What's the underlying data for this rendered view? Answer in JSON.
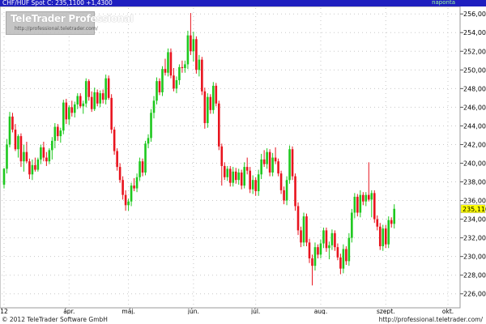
{
  "header": {
    "left_text": "CHF/HUF Spot C: 235,1100 +1,4300",
    "right_text": "naponta"
  },
  "watermark": {
    "name": "TeleTrader Professional",
    "url": "http://professional.teletrader.com/"
  },
  "footer": {
    "copyright": "© 2012 TeleTrader Software GmbH",
    "url": "http://professional.teletrader.com/"
  },
  "colors": {
    "up": "#1ec81e",
    "down": "#e8141e",
    "grid": "#c8c8c8",
    "background": "#ffffff",
    "title_bar": "#1f1fbf",
    "current_price_label": "#ffff00"
  },
  "chart_data": {
    "type": "candlestick",
    "ylim": [
      224.5,
      256.8
    ],
    "yticks": [
      "256,0000",
      "254,0000",
      "252,0000",
      "250,0000",
      "248,0000",
      "246,0000",
      "244,0000",
      "242,0000",
      "240,0000",
      "238,0000",
      "236,0000",
      "234,0000",
      "232,0000",
      "230,0000",
      "228,0000",
      "226,0000"
    ],
    "ytick_values": [
      256,
      254,
      252,
      250,
      248,
      246,
      244,
      242,
      240,
      238,
      236,
      234,
      232,
      230,
      228,
      226
    ],
    "current_price": {
      "label": "235,1100",
      "value": 235.11
    },
    "xticks": [
      {
        "label": "12",
        "index": 0
      },
      {
        "label": "ápr.",
        "index": 23
      },
      {
        "label": "máj.",
        "index": 44
      },
      {
        "label": "jún.",
        "index": 67
      },
      {
        "label": "júl.",
        "index": 89
      },
      {
        "label": "aug.",
        "index": 112
      },
      {
        "label": "szept.",
        "index": 135
      },
      {
        "label": "okt.",
        "index": 157
      }
    ],
    "n_slots": 161,
    "candles": [
      [
        0,
        237.7,
        239.5,
        237.3,
        239.4
      ],
      [
        1,
        239.4,
        242.6,
        238.9,
        242.0
      ],
      [
        2,
        242.0,
        245.5,
        241.7,
        245.0
      ],
      [
        3,
        245.0,
        245.4,
        243.3,
        243.6
      ],
      [
        4,
        243.6,
        244.2,
        241.3,
        241.5
      ],
      [
        5,
        241.5,
        243.1,
        240.6,
        242.9
      ],
      [
        6,
        242.9,
        243.2,
        239.6,
        240.2
      ],
      [
        7,
        240.2,
        242.0,
        239.1,
        241.2
      ],
      [
        8,
        241.2,
        242.3,
        240.0,
        240.2
      ],
      [
        9,
        240.2,
        240.5,
        238.3,
        238.8
      ],
      [
        10,
        238.8,
        240.4,
        238.2,
        239.8
      ],
      [
        11,
        239.8,
        240.6,
        239.1,
        239.3
      ],
      [
        12,
        239.3,
        240.6,
        239.1,
        240.4
      ],
      [
        13,
        240.4,
        242.0,
        239.9,
        241.7
      ],
      [
        14,
        241.7,
        242.3,
        240.2,
        240.6
      ],
      [
        15,
        240.6,
        241.2,
        239.7,
        240.2
      ],
      [
        16,
        240.2,
        241.6,
        239.9,
        241.4
      ],
      [
        17,
        241.4,
        242.8,
        240.4,
        242.4
      ],
      [
        18,
        242.4,
        244.3,
        241.6,
        243.9
      ],
      [
        19,
        243.9,
        244.2,
        242.4,
        242.9
      ],
      [
        20,
        242.9,
        243.8,
        242.2,
        243.5
      ],
      [
        21,
        243.5,
        246.8,
        243.1,
        246.5
      ],
      [
        22,
        246.5,
        246.9,
        244.2,
        244.7
      ],
      [
        23,
        244.7,
        246.2,
        244.1,
        246.0
      ],
      [
        24,
        246.0,
        246.7,
        245.0,
        245.4
      ],
      [
        25,
        245.4,
        246.6,
        244.9,
        246.3
      ],
      [
        26,
        246.3,
        247.5,
        245.8,
        247.2
      ],
      [
        27,
        247.2,
        247.5,
        245.9,
        246.1
      ],
      [
        28,
        246.1,
        246.7,
        245.3,
        246.4
      ],
      [
        29,
        246.4,
        249.1,
        246.0,
        248.8
      ],
      [
        30,
        248.8,
        249.0,
        246.7,
        247.1
      ],
      [
        31,
        247.1,
        247.7,
        245.5,
        245.8
      ],
      [
        32,
        245.8,
        248.1,
        245.6,
        247.6
      ],
      [
        33,
        247.6,
        247.9,
        246.1,
        246.4
      ],
      [
        34,
        246.4,
        247.8,
        246.0,
        247.5
      ],
      [
        35,
        247.5,
        247.9,
        246.4,
        246.8
      ],
      [
        36,
        246.8,
        249.5,
        246.3,
        249.1
      ],
      [
        37,
        249.1,
        249.4,
        246.8,
        247.0
      ],
      [
        38,
        247.0,
        247.4,
        243.2,
        243.6
      ],
      [
        39,
        243.6,
        243.9,
        240.9,
        241.3
      ],
      [
        40,
        241.3,
        241.6,
        239.2,
        239.6
      ],
      [
        41,
        239.6,
        240.0,
        237.9,
        238.2
      ],
      [
        42,
        238.2,
        238.6,
        236.1,
        236.6
      ],
      [
        43,
        236.6,
        237.1,
        234.9,
        235.5
      ],
      [
        44,
        235.5,
        236.2,
        234.9,
        235.9
      ],
      [
        45,
        235.9,
        237.9,
        235.4,
        237.6
      ],
      [
        46,
        237.6,
        238.4,
        237.0,
        237.3
      ],
      [
        47,
        237.3,
        238.9,
        236.9,
        238.5
      ],
      [
        48,
        238.5,
        240.6,
        238.1,
        240.2
      ],
      [
        49,
        240.2,
        240.5,
        238.6,
        239.0
      ],
      [
        50,
        239.0,
        242.4,
        238.7,
        242.1
      ],
      [
        51,
        242.1,
        243.1,
        241.6,
        242.7
      ],
      [
        52,
        242.7,
        245.8,
        242.3,
        245.4
      ],
      [
        53,
        245.4,
        247.2,
        244.8,
        246.7
      ],
      [
        54,
        246.7,
        249.2,
        246.3,
        248.8
      ],
      [
        55,
        248.8,
        249.1,
        247.3,
        247.6
      ],
      [
        56,
        247.6,
        250.4,
        247.2,
        250.1
      ],
      [
        57,
        250.1,
        251.2,
        249.4,
        249.7
      ],
      [
        58,
        249.7,
        252.3,
        249.3,
        251.9
      ],
      [
        59,
        251.9,
        252.3,
        249.1,
        249.4
      ],
      [
        60,
        249.4,
        250.2,
        247.7,
        248.0
      ],
      [
        61,
        248.0,
        249.3,
        247.5,
        248.9
      ],
      [
        62,
        248.9,
        250.6,
        248.4,
        250.3
      ],
      [
        63,
        250.3,
        251.0,
        249.7,
        250.2
      ],
      [
        64,
        250.2,
        251.0,
        249.7,
        250.6
      ],
      [
        65,
        250.6,
        254.2,
        250.1,
        253.7
      ],
      [
        66,
        253.7,
        256.1,
        251.6,
        252.0
      ],
      [
        67,
        252.0,
        254.1,
        250.9,
        253.3
      ],
      [
        68,
        253.3,
        253.6,
        249.6,
        250.0
      ],
      [
        69,
        250.0,
        251.6,
        249.3,
        251.1
      ],
      [
        70,
        251.1,
        251.4,
        247.3,
        247.7
      ],
      [
        71,
        247.7,
        248.1,
        243.7,
        244.3
      ],
      [
        72,
        244.3,
        247.5,
        243.8,
        247.1
      ],
      [
        73,
        247.1,
        247.4,
        245.3,
        245.7
      ],
      [
        74,
        245.7,
        248.7,
        245.3,
        248.3
      ],
      [
        75,
        248.3,
        248.6,
        246.1,
        246.4
      ],
      [
        76,
        246.4,
        246.7,
        241.4,
        241.8
      ],
      [
        77,
        241.8,
        242.1,
        237.6,
        239.7
      ],
      [
        78,
        239.7,
        240.1,
        238.2,
        238.5
      ],
      [
        79,
        238.5,
        239.7,
        238.1,
        239.4
      ],
      [
        80,
        239.4,
        239.7,
        237.5,
        237.9
      ],
      [
        81,
        237.9,
        239.6,
        237.5,
        239.1
      ],
      [
        82,
        239.1,
        239.5,
        237.8,
        238.2
      ],
      [
        83,
        238.2,
        239.4,
        237.7,
        239.0
      ],
      [
        84,
        239.0,
        239.3,
        237.2,
        237.6
      ],
      [
        85,
        237.6,
        240.1,
        237.3,
        239.6
      ],
      [
        86,
        239.6,
        240.6,
        238.8,
        239.2
      ],
      [
        87,
        239.2,
        239.6,
        236.8,
        237.2
      ],
      [
        88,
        237.2,
        238.7,
        236.7,
        238.2
      ],
      [
        89,
        238.2,
        238.5,
        236.5,
        237.0
      ],
      [
        90,
        237.0,
        239.3,
        236.5,
        238.8
      ],
      [
        91,
        238.8,
        241.0,
        238.3,
        240.4
      ],
      [
        92,
        240.4,
        241.4,
        239.6,
        239.9
      ],
      [
        93,
        239.9,
        241.6,
        239.4,
        241.2
      ],
      [
        94,
        241.2,
        241.5,
        238.6,
        239.0
      ],
      [
        95,
        239.0,
        241.1,
        238.6,
        240.6
      ],
      [
        96,
        240.6,
        241.7,
        239.9,
        240.2
      ],
      [
        97,
        240.2,
        240.5,
        238.6,
        238.9
      ],
      [
        98,
        238.9,
        239.2,
        236.7,
        237.1
      ],
      [
        99,
        237.1,
        237.5,
        235.6,
        236.0
      ],
      [
        100,
        236.0,
        238.6,
        235.5,
        238.2
      ],
      [
        101,
        238.2,
        241.9,
        237.8,
        241.5
      ],
      [
        102,
        241.5,
        241.8,
        238.2,
        238.6
      ],
      [
        103,
        238.6,
        238.9,
        234.9,
        235.4
      ],
      [
        104,
        235.4,
        235.8,
        232.3,
        232.8
      ],
      [
        105,
        232.8,
        233.2,
        231.0,
        231.5
      ],
      [
        106,
        231.5,
        234.7,
        231.1,
        234.3
      ],
      [
        107,
        234.3,
        234.6,
        231.1,
        231.5
      ],
      [
        108,
        231.5,
        231.9,
        229.3,
        229.8
      ],
      [
        109,
        229.8,
        230.2,
        226.9,
        229.0
      ],
      [
        110,
        229.0,
        231.5,
        228.5,
        231.0
      ],
      [
        111,
        231.0,
        231.3,
        229.8,
        230.2
      ],
      [
        112,
        230.2,
        231.8,
        229.8,
        231.4
      ],
      [
        113,
        231.4,
        233.1,
        230.9,
        232.8
      ],
      [
        114,
        232.8,
        233.1,
        230.5,
        230.9
      ],
      [
        115,
        230.9,
        231.6,
        229.7,
        231.2
      ],
      [
        116,
        231.2,
        232.9,
        230.7,
        232.5
      ],
      [
        117,
        232.5,
        232.8,
        230.6,
        231.0
      ],
      [
        118,
        231.0,
        231.4,
        229.6,
        229.9
      ],
      [
        119,
        229.9,
        230.3,
        228.1,
        228.7
      ],
      [
        120,
        228.7,
        231.3,
        228.2,
        230.8
      ],
      [
        121,
        230.8,
        231.1,
        229.1,
        229.5
      ],
      [
        122,
        229.5,
        232.5,
        229.0,
        232.0
      ],
      [
        123,
        232.0,
        235.1,
        231.5,
        234.7
      ],
      [
        124,
        234.7,
        236.8,
        234.1,
        236.4
      ],
      [
        125,
        236.4,
        236.7,
        234.3,
        234.7
      ],
      [
        126,
        234.7,
        237.1,
        234.2,
        236.6
      ],
      [
        127,
        236.6,
        236.9,
        235.5,
        235.9
      ],
      [
        128,
        235.9,
        236.9,
        235.4,
        236.6
      ],
      [
        129,
        236.6,
        240.1,
        235.9,
        236.1
      ],
      [
        130,
        236.1,
        237.1,
        234.2,
        236.8
      ],
      [
        131,
        236.8,
        237.1,
        233.6,
        234.0
      ],
      [
        132,
        234.0,
        234.4,
        232.8,
        233.2
      ],
      [
        133,
        233.2,
        233.6,
        230.7,
        231.1
      ],
      [
        134,
        231.1,
        233.4,
        230.6,
        233.0
      ],
      [
        135,
        233.0,
        233.4,
        230.9,
        231.3
      ],
      [
        136,
        231.3,
        234.3,
        230.9,
        233.9
      ],
      [
        137,
        233.9,
        234.2,
        233.1,
        233.5
      ],
      [
        138,
        233.5,
        235.6,
        233.0,
        235.11
      ]
    ]
  }
}
